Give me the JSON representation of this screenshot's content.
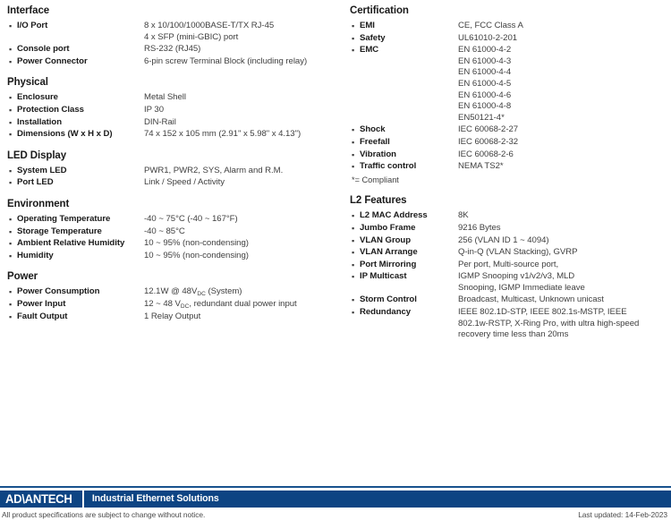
{
  "left_column": [
    {
      "title": "Interface",
      "rows": [
        {
          "label": "I/O Port",
          "value": "8 x 10/100/1000BASE-T/TX RJ-45\n4 x SFP (mini-GBIC) port"
        },
        {
          "label": "Console port",
          "value": "RS-232 (RJ45)"
        },
        {
          "label": "Power Connector",
          "value": "6-pin screw Terminal Block (including relay)"
        }
      ]
    },
    {
      "title": "Physical",
      "rows": [
        {
          "label": "Enclosure",
          "value": "Metal Shell"
        },
        {
          "label": "Protection Class",
          "value": "IP 30"
        },
        {
          "label": "Installation",
          "value": "DIN-Rail"
        },
        {
          "label": "Dimensions (W x H x D)",
          "value": "74 x 152 x 105 mm (2.91\" x 5.98\" x 4.13\")"
        }
      ]
    },
    {
      "title": "LED Display",
      "rows": [
        {
          "label": "System LED",
          "value": "PWR1, PWR2, SYS, Alarm and R.M."
        },
        {
          "label": "Port LED",
          "value": "Link / Speed / Activity"
        }
      ]
    },
    {
      "title": "Environment",
      "rows": [
        {
          "label": "Operating Temperature",
          "value": "-40 ~ 75°C (-40 ~ 167°F)"
        },
        {
          "label": "Storage Temperature",
          "value": "-40 ~ 85°C"
        },
        {
          "label": "Ambient Relative Humidity",
          "value": "10 ~ 95% (non-condensing)"
        },
        {
          "label": "Humidity",
          "value": "10 ~ 95% (non-condensing)"
        }
      ]
    },
    {
      "title": "Power",
      "rows": [
        {
          "label": "Power Consumption",
          "value_html": "12.1W @ 48V<sub>DC</sub> (System)"
        },
        {
          "label": "Power Input",
          "value_html": "12 ~ 48 V<sub>DC</sub>, redundant dual power input"
        },
        {
          "label": "Fault Output",
          "value": "1 Relay Output"
        }
      ]
    }
  ],
  "right_column": [
    {
      "title": "Certification",
      "rows": [
        {
          "label": "EMI",
          "value": "CE, FCC Class A"
        },
        {
          "label": "Safety",
          "value": "UL61010-2-201"
        },
        {
          "label": "EMC",
          "value": "EN 61000-4-2\nEN 61000-4-3\nEN 61000-4-4\nEN 61000-4-5\nEN 61000-4-6\nEN 61000-4-8\nEN50121-4*"
        },
        {
          "label": "Shock",
          "value": "IEC 60068-2-27"
        },
        {
          "label": "Freefall",
          "value": "IEC 60068-2-32"
        },
        {
          "label": "Vibration",
          "value": "IEC 60068-2-6"
        },
        {
          "label": "Traffic control",
          "value": "NEMA TS2*"
        }
      ],
      "footnote": "*= Compliant"
    },
    {
      "title": "L2 Features",
      "rows": [
        {
          "label": "L2 MAC Address",
          "value": "8K"
        },
        {
          "label": "Jumbo Frame",
          "value": "9216 Bytes"
        },
        {
          "label": "VLAN Group",
          "value": "256 (VLAN ID 1 ~ 4094)"
        },
        {
          "label": "VLAN Arrange",
          "value": "Q-in-Q (VLAN Stacking), GVRP"
        },
        {
          "label": "Port Mirroring",
          "value": "Per port, Multi-source port,"
        },
        {
          "label": "IP Multicast",
          "value": "IGMP Snooping v1/v2/v3, MLD\nSnooping, IGMP Immediate leave"
        },
        {
          "label": "Storm Control",
          "value": "Broadcast, Multicast, Unknown unicast"
        },
        {
          "label": "Redundancy",
          "value": "IEEE 802.1D-STP, IEEE 802.1s-MSTP, IEEE\n802.1w-RSTP, X-Ring Pro, with ultra high-speed\nrecovery time less than 20ms"
        }
      ]
    }
  ],
  "footer": {
    "logo_text": "AD\\ANTECH",
    "tagline": "Industrial Ethernet Solutions",
    "disclaimer": "All product specifications are subject to change without notice.",
    "last_updated": "Last updated: 14-Feb-2023",
    "bar_color": "#0d4483",
    "rule_color": "#19538e"
  }
}
